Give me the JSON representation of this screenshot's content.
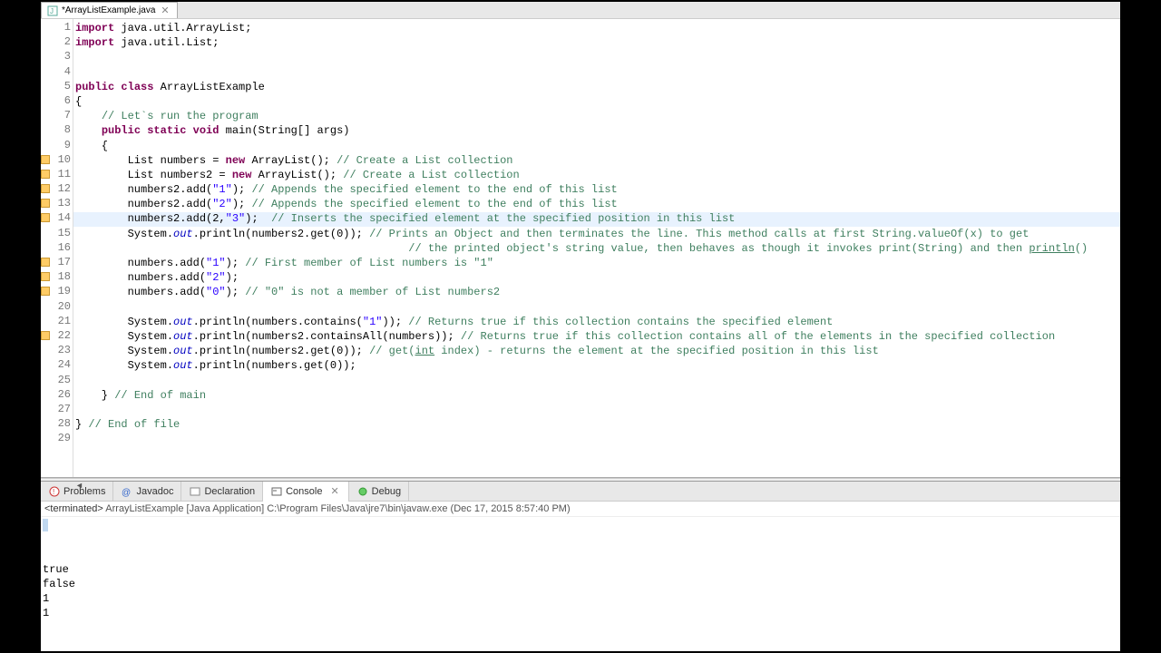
{
  "tab": {
    "title": "*ArrayListExample.java"
  },
  "gutter": {
    "markers": [
      10,
      11,
      12,
      13,
      14,
      17,
      18,
      19,
      22
    ],
    "expand": [
      1,
      8
    ]
  },
  "highlightedLine": 14,
  "code": [
    {
      "n": 1,
      "segs": [
        {
          "t": "import",
          "c": "kw"
        },
        {
          "t": " java.util.ArrayList;"
        }
      ]
    },
    {
      "n": 2,
      "segs": [
        {
          "t": "import",
          "c": "kw"
        },
        {
          "t": " java.util.List;"
        }
      ]
    },
    {
      "n": 3,
      "segs": [
        {
          "t": ""
        }
      ]
    },
    {
      "n": 4,
      "segs": [
        {
          "t": ""
        }
      ]
    },
    {
      "n": 5,
      "segs": [
        {
          "t": "public",
          "c": "kw"
        },
        {
          "t": " "
        },
        {
          "t": "class",
          "c": "kw"
        },
        {
          "t": " ArrayListExample"
        }
      ]
    },
    {
      "n": 6,
      "segs": [
        {
          "t": "{"
        }
      ]
    },
    {
      "n": 7,
      "segs": [
        {
          "t": "    "
        },
        {
          "t": "// Let`s run the program",
          "c": "cm"
        }
      ]
    },
    {
      "n": 8,
      "segs": [
        {
          "t": "    "
        },
        {
          "t": "public",
          "c": "kw"
        },
        {
          "t": " "
        },
        {
          "t": "static",
          "c": "kw"
        },
        {
          "t": " "
        },
        {
          "t": "void",
          "c": "kw"
        },
        {
          "t": " main(String[] args)"
        }
      ]
    },
    {
      "n": 9,
      "segs": [
        {
          "t": "    {"
        }
      ]
    },
    {
      "n": 10,
      "segs": [
        {
          "t": "        List numbers = "
        },
        {
          "t": "new",
          "c": "kw"
        },
        {
          "t": " ArrayList(); "
        },
        {
          "t": "// Create a List collection",
          "c": "cm"
        }
      ]
    },
    {
      "n": 11,
      "segs": [
        {
          "t": "        List numbers2 = "
        },
        {
          "t": "new",
          "c": "kw"
        },
        {
          "t": " ArrayList(); "
        },
        {
          "t": "// Create a List collection",
          "c": "cm"
        }
      ]
    },
    {
      "n": 12,
      "segs": [
        {
          "t": "        numbers2.add("
        },
        {
          "t": "\"1\"",
          "c": "str"
        },
        {
          "t": "); "
        },
        {
          "t": "// Appends the specified element to the end of this list",
          "c": "cm"
        }
      ]
    },
    {
      "n": 13,
      "segs": [
        {
          "t": "        numbers2.add("
        },
        {
          "t": "\"2\"",
          "c": "str"
        },
        {
          "t": "); "
        },
        {
          "t": "// Appends the specified element to the end of this list",
          "c": "cm"
        }
      ]
    },
    {
      "n": 14,
      "segs": [
        {
          "t": "        numbers2.add(2,"
        },
        {
          "t": "\"3\"",
          "c": "str"
        },
        {
          "t": ");  "
        },
        {
          "t": "// Inserts the specified element at the specified position in this list",
          "c": "cm"
        }
      ]
    },
    {
      "n": 15,
      "segs": [
        {
          "t": "        System."
        },
        {
          "t": "out",
          "c": "fld"
        },
        {
          "t": ".println(numbers2.get(0)); "
        },
        {
          "t": "// Prints an Object and then terminates the line. This method calls at first String.valueOf(x) to get",
          "c": "cm"
        }
      ]
    },
    {
      "n": 16,
      "segs": [
        {
          "t": "                                                   "
        },
        {
          "t": "// the printed object's string value, then behaves as though it invokes print(String) and then ",
          "c": "cm"
        },
        {
          "t": "println",
          "u": true,
          "c": "cm"
        },
        {
          "t": "()",
          "c": "cm"
        }
      ]
    },
    {
      "n": 17,
      "segs": [
        {
          "t": "        numbers.add("
        },
        {
          "t": "\"1\"",
          "c": "str"
        },
        {
          "t": "); "
        },
        {
          "t": "// First member of List numbers is \"1\"",
          "c": "cm"
        }
      ]
    },
    {
      "n": 18,
      "segs": [
        {
          "t": "        numbers.add("
        },
        {
          "t": "\"2\"",
          "c": "str"
        },
        {
          "t": ");"
        }
      ]
    },
    {
      "n": 19,
      "segs": [
        {
          "t": "        numbers.add("
        },
        {
          "t": "\"0\"",
          "c": "str"
        },
        {
          "t": "); "
        },
        {
          "t": "// \"0\" is not a member of List numbers2",
          "c": "cm"
        }
      ]
    },
    {
      "n": 20,
      "segs": [
        {
          "t": ""
        }
      ]
    },
    {
      "n": 21,
      "segs": [
        {
          "t": "        System."
        },
        {
          "t": "out",
          "c": "fld"
        },
        {
          "t": ".println(numbers.contains("
        },
        {
          "t": "\"1\"",
          "c": "str"
        },
        {
          "t": ")); "
        },
        {
          "t": "// Returns true if this collection contains the specified element",
          "c": "cm"
        }
      ]
    },
    {
      "n": 22,
      "segs": [
        {
          "t": "        System."
        },
        {
          "t": "out",
          "c": "fld"
        },
        {
          "t": ".println(numbers2.containsAll(numbers)); "
        },
        {
          "t": "// Returns true if this collection contains all of the elements in the specified collection",
          "c": "cm"
        }
      ]
    },
    {
      "n": 23,
      "segs": [
        {
          "t": "        System."
        },
        {
          "t": "out",
          "c": "fld"
        },
        {
          "t": ".println(numbers2.get(0)); "
        },
        {
          "t": "// get(",
          "c": "cm"
        },
        {
          "t": "int",
          "c": "cm",
          "u": true
        },
        {
          "t": " index) - returns the element at the specified position in this list",
          "c": "cm"
        }
      ]
    },
    {
      "n": 24,
      "segs": [
        {
          "t": "        System."
        },
        {
          "t": "out",
          "c": "fld"
        },
        {
          "t": ".println(numbers.get(0));"
        }
      ]
    },
    {
      "n": 25,
      "segs": [
        {
          "t": ""
        }
      ]
    },
    {
      "n": 26,
      "segs": [
        {
          "t": "    } "
        },
        {
          "t": "// End of main",
          "c": "cm"
        }
      ]
    },
    {
      "n": 27,
      "segs": [
        {
          "t": ""
        }
      ]
    },
    {
      "n": 28,
      "segs": [
        {
          "t": "} "
        },
        {
          "t": "// End of file",
          "c": "cm"
        }
      ]
    },
    {
      "n": 29,
      "segs": [
        {
          "t": ""
        }
      ]
    }
  ],
  "bottomTabs": {
    "problems": "Problems",
    "javadoc": "Javadoc",
    "declaration": "Declaration",
    "console": "Console",
    "debug": "Debug"
  },
  "terminated": {
    "prefix": "<terminated> ",
    "app": "ArrayListExample [Java Application] C:\\Program Files\\Java\\jre7\\bin\\javaw.exe (Dec 17, 2015 8:57:40 PM)"
  },
  "consoleOutput": "true\nfalse\n1\n1"
}
